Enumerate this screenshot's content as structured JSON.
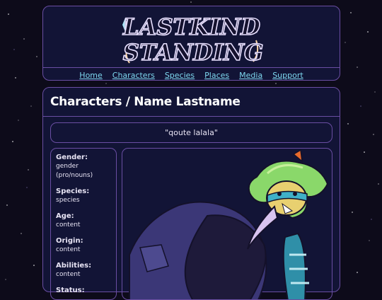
{
  "site": {
    "logo_line1": "LASTKIND",
    "logo_line2": "STANDING"
  },
  "nav": {
    "items": [
      {
        "label": "Home"
      },
      {
        "label": "Characters"
      },
      {
        "label": "Species"
      },
      {
        "label": "Places"
      },
      {
        "label": "Media"
      },
      {
        "label": "Support"
      }
    ]
  },
  "page": {
    "title": "Characters / Name Lastname",
    "quote": "\"qoute lalala\""
  },
  "info": {
    "fields": [
      {
        "label": "Gender:",
        "value": "gender (pro/nouns)"
      },
      {
        "label": "Species:",
        "value": "species"
      },
      {
        "label": "Age:",
        "value": "content"
      },
      {
        "label": "Origin:",
        "value": "content"
      },
      {
        "label": "Abilities:",
        "value": "content"
      },
      {
        "label": "Status:",
        "value": ""
      }
    ]
  },
  "colors": {
    "background": "#0d0b1a",
    "panel": "#121436",
    "border": "#6a4ea3",
    "link": "#7ed8f0"
  },
  "icons": {
    "art": "character-illustration"
  }
}
